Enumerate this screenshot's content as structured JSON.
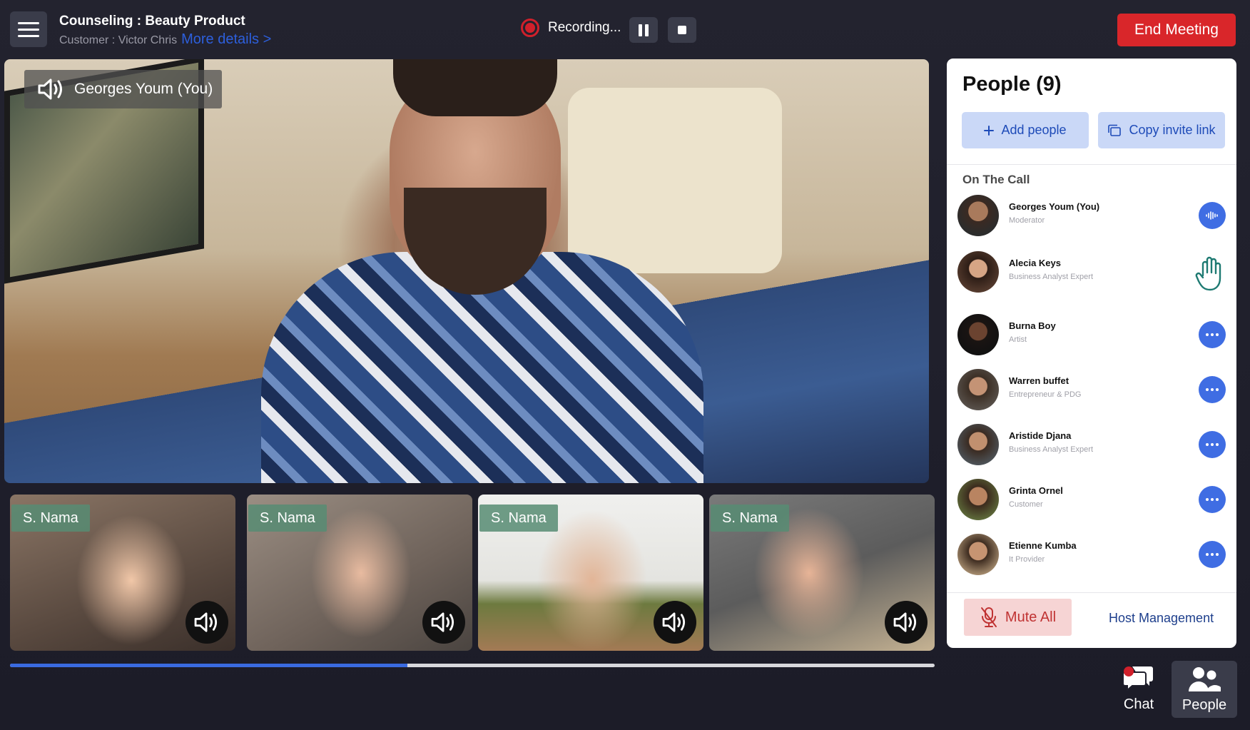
{
  "header": {
    "title": "Counseling : Beauty Product",
    "customer": "Customer : Victor Chris",
    "more_details": "More details  >",
    "recording_label": "Recording...",
    "end_meeting": "End Meeting"
  },
  "main_video": {
    "speaker_name": "Georges Youm (You)"
  },
  "thumbnails": [
    {
      "name": "S. Nama"
    },
    {
      "name": "S. Nama"
    },
    {
      "name": "S. Nama"
    },
    {
      "name": "S. Nama"
    }
  ],
  "progress": 0.43,
  "people_panel": {
    "title": "People (9)",
    "add_people": "Add people",
    "copy_invite": "Copy invite link",
    "section_label": "On The Call",
    "people": [
      {
        "name": "Georges Youm (You)",
        "role": "Moderator",
        "action": "speaking"
      },
      {
        "name": "Alecia Keys",
        "role": "Business Analyst Expert",
        "action": "hand-raised"
      },
      {
        "name": "Burna Boy",
        "role": "Artist",
        "action": "more"
      },
      {
        "name": "Warren buffet",
        "role": "Entrepreneur & PDG",
        "action": "more"
      },
      {
        "name": "Aristide Djana",
        "role": "Business Analyst Expert",
        "action": "more"
      },
      {
        "name": "Grinta Ornel",
        "role": "Customer",
        "action": "more"
      },
      {
        "name": "Etienne Kumba",
        "role": "It Provider",
        "action": "more"
      }
    ],
    "mute_all": "Mute All",
    "host_management": "Host Management"
  },
  "bottom_nav": {
    "chat": "Chat",
    "people": "People"
  },
  "colors": {
    "accent": "#3f6de3",
    "end_meeting": "#d9262a",
    "recording": "#d0202b",
    "background": "#1f1f2c"
  }
}
